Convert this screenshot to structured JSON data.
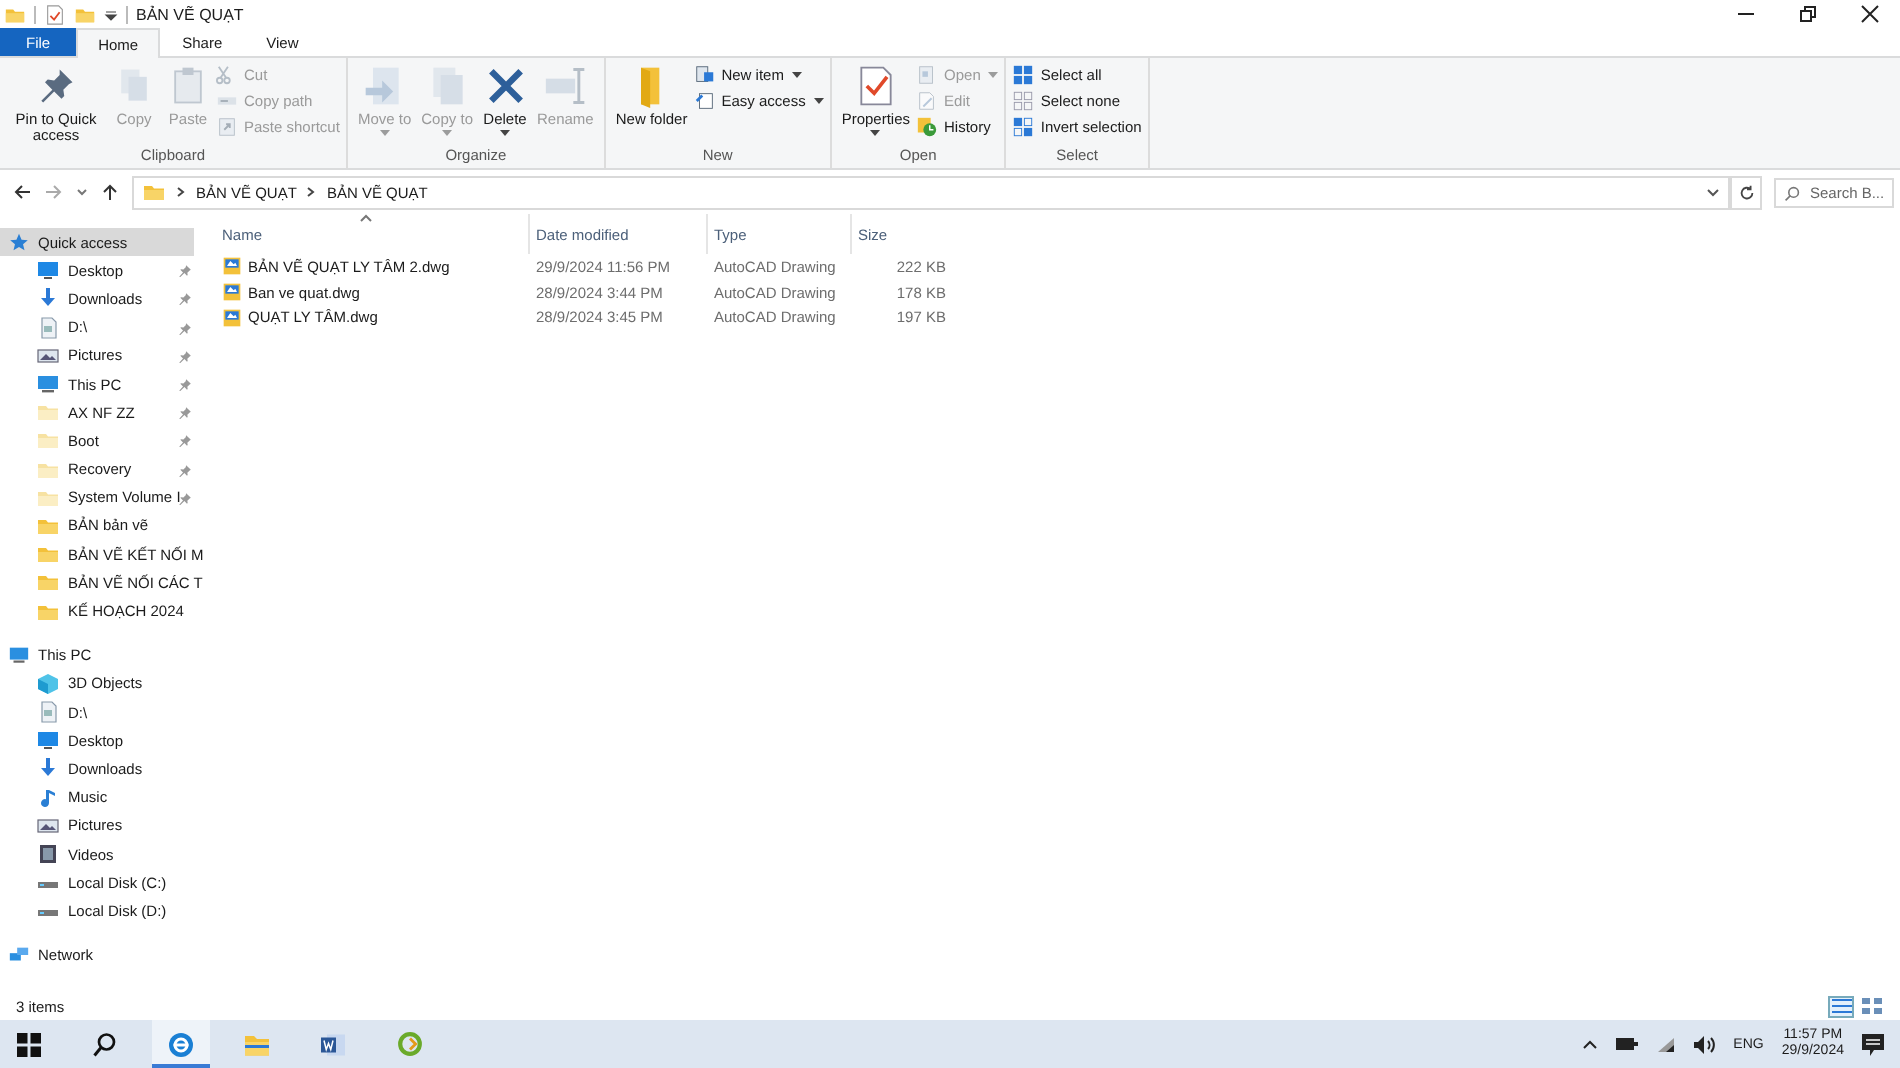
{
  "window": {
    "title": "BẢN VẼ QUẠT"
  },
  "tabs": [
    {
      "label": "File",
      "kind": "file",
      "selected": false
    },
    {
      "label": "Home",
      "kind": "tab",
      "selected": true
    },
    {
      "label": "Share",
      "kind": "tab",
      "selected": false
    },
    {
      "label": "View",
      "kind": "tab",
      "selected": false
    }
  ],
  "ribbon": [
    {
      "label": "Clipboard",
      "items": [
        {
          "label": "Pin to Quick access",
          "kind": "big",
          "disabled": false,
          "dropdown": false
        },
        {
          "label": "Copy",
          "kind": "big",
          "disabled": true,
          "dropdown": false
        },
        {
          "label": "Paste",
          "kind": "big",
          "disabled": true,
          "dropdown": false
        },
        {
          "label": "Cut",
          "kind": "small",
          "disabled": true,
          "dropdown": false
        },
        {
          "label": "Copy path",
          "kind": "small",
          "disabled": true,
          "dropdown": false
        },
        {
          "label": "Paste shortcut",
          "kind": "small",
          "disabled": true,
          "dropdown": false
        }
      ]
    },
    {
      "label": "Organize",
      "items": [
        {
          "label": "Move to",
          "kind": "big",
          "disabled": true,
          "dropdown": true
        },
        {
          "label": "Copy to",
          "kind": "big",
          "disabled": true,
          "dropdown": true
        },
        {
          "label": "Delete",
          "kind": "big",
          "disabled": false,
          "dropdown": true
        },
        {
          "label": "Rename",
          "kind": "big",
          "disabled": true,
          "dropdown": false
        }
      ]
    },
    {
      "label": "New",
      "items": [
        {
          "label": "New folder",
          "kind": "big",
          "disabled": false,
          "dropdown": false
        },
        {
          "label": "New item",
          "kind": "small",
          "disabled": false,
          "dropdown": true
        },
        {
          "label": "Easy access",
          "kind": "small",
          "disabled": false,
          "dropdown": true
        }
      ]
    },
    {
      "label": "Open",
      "items": [
        {
          "label": "Properties",
          "kind": "big",
          "disabled": false,
          "dropdown": true
        },
        {
          "label": "Open",
          "kind": "small",
          "disabled": true,
          "dropdown": true
        },
        {
          "label": "Edit",
          "kind": "small",
          "disabled": true,
          "dropdown": false
        },
        {
          "label": "History",
          "kind": "small",
          "disabled": false,
          "dropdown": false
        }
      ]
    },
    {
      "label": "Select",
      "items": [
        {
          "label": "Select all",
          "kind": "small",
          "disabled": false,
          "dropdown": false
        },
        {
          "label": "Select none",
          "kind": "small",
          "disabled": false,
          "dropdown": false
        },
        {
          "label": "Invert selection",
          "kind": "small",
          "disabled": false,
          "dropdown": false
        }
      ]
    }
  ],
  "address": {
    "path": [
      "BẢN VẼ QUẠT",
      "BẢN VẼ QUẠT"
    ],
    "search_placeholder": "Search B..."
  },
  "sidebar": {
    "items": [
      {
        "label": "Quick access",
        "selected": true,
        "children": [
          {
            "label": "Desktop",
            "pinned": true,
            "hidden": false,
            "selected": false
          },
          {
            "label": "Downloads",
            "pinned": true,
            "hidden": false,
            "selected": false
          },
          {
            "label": "D:\\",
            "pinned": true,
            "hidden": false,
            "selected": false
          },
          {
            "label": "Pictures",
            "pinned": true,
            "hidden": false,
            "selected": false
          },
          {
            "label": "This PC",
            "pinned": true,
            "hidden": false,
            "selected": false
          },
          {
            "label": "AX NF ZZ",
            "pinned": true,
            "hidden": true,
            "selected": false
          },
          {
            "label": "Boot",
            "pinned": true,
            "hidden": true,
            "selected": false
          },
          {
            "label": "Recovery",
            "pinned": true,
            "hidden": true,
            "selected": false
          },
          {
            "label": "System Volume I",
            "pinned": true,
            "hidden": true,
            "selected": false
          },
          {
            "label": "BẢN bản vẽ",
            "pinned": false,
            "hidden": false,
            "selected": false
          },
          {
            "label": "BẢN VẼ KẾT NỐI M",
            "pinned": false,
            "hidden": false,
            "selected": false
          },
          {
            "label": "BẢN VẼ NỐI CÁC T",
            "pinned": false,
            "hidden": false,
            "selected": false
          },
          {
            "label": "KẾ HOẠCH 2024",
            "pinned": false,
            "hidden": false,
            "selected": false
          }
        ]
      },
      {
        "label": "This PC",
        "selected": false,
        "children": [
          {
            "label": "3D Objects",
            "selected": false
          },
          {
            "label": "D:\\",
            "selected": false
          },
          {
            "label": "Desktop",
            "selected": false
          },
          {
            "label": "Downloads",
            "selected": false
          },
          {
            "label": "Music",
            "selected": false
          },
          {
            "label": "Pictures",
            "selected": false
          },
          {
            "label": "Videos",
            "selected": false
          },
          {
            "label": "Local Disk (C:)",
            "selected": false
          },
          {
            "label": "Local Disk (D:)",
            "selected": false
          }
        ]
      },
      {
        "label": "Network",
        "selected": false
      }
    ]
  },
  "table": {
    "columns": [
      "Name",
      "Date modified",
      "Type",
      "Size"
    ],
    "rows": [
      {
        "name": "BẢN VẼ QUẠT LY TÂM 2.dwg",
        "date": "29/9/2024 11:56 PM",
        "type": "AutoCAD Drawing",
        "size": "222 KB",
        "selected": false
      },
      {
        "name": "Ban ve quat.dwg",
        "date": "28/9/2024 3:44 PM",
        "type": "AutoCAD Drawing",
        "size": "178 KB",
        "selected": false
      },
      {
        "name": "QUẠT LY TÂM.dwg",
        "date": "28/9/2024 3:45 PM",
        "type": "AutoCAD Drawing",
        "size": "197 KB",
        "selected": false
      }
    ]
  },
  "status_bar": {
    "text": "3 items",
    "view_buttons": [
      {
        "selected": true
      },
      {
        "selected": false
      }
    ]
  },
  "taskbar": {
    "apps": [
      {
        "selected": false
      },
      {
        "selected": false
      },
      {
        "selected": true
      },
      {
        "selected": false
      },
      {
        "selected": false
      }
    ],
    "language": "ENG",
    "time": "11:57 PM",
    "date": "29/9/2024"
  }
}
